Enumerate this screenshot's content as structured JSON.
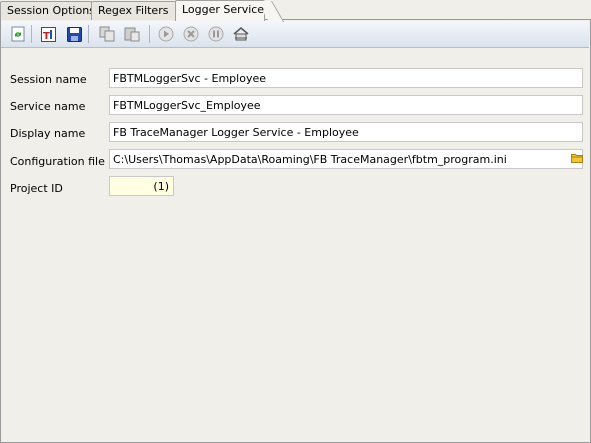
{
  "tabs": [
    {
      "label": "Session Options"
    },
    {
      "label": "Regex Filters"
    },
    {
      "label": "Logger Service"
    }
  ],
  "toolbar_icons": [
    "refresh-icon",
    "text-icon",
    "save-icon",
    "copy-icon",
    "paste-icon",
    "play-icon",
    "stop-icon",
    "pause-icon",
    "service-icon"
  ],
  "form": {
    "session_name_label": "Session name",
    "session_name_value": "FBTMLoggerSvc - Employee",
    "service_name_label": "Service name",
    "service_name_value": "FBTMLoggerSvc_Employee",
    "display_name_label": "Display name",
    "display_name_value": "FB TraceManager Logger Service - Employee",
    "config_file_label": "Configuration file",
    "config_file_value": "C:\\Users\\Thomas\\AppData\\Roaming\\FB TraceManager\\fbtm_program.ini",
    "project_id_label": "Project ID",
    "project_id_value": "(1)"
  },
  "colors": {
    "toolbar_top": "#f4f7fb",
    "toolbar_bottom": "#dbe3ee",
    "project_field": "#ffffe1"
  }
}
